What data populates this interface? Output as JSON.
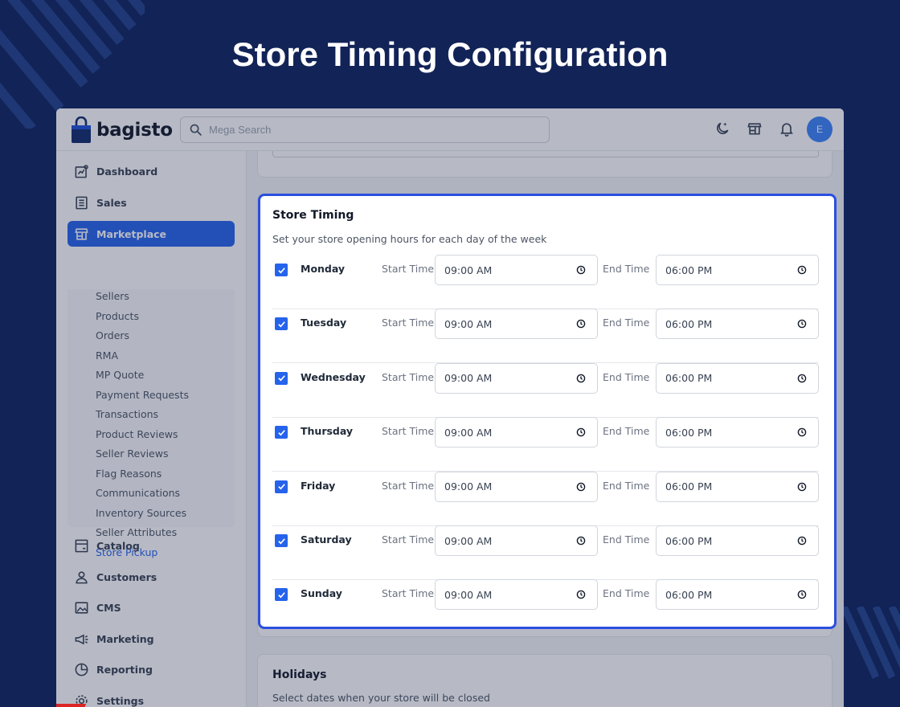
{
  "hero": {
    "title": "Store Timing Configuration"
  },
  "header": {
    "logo_text": "bagisto",
    "search_placeholder": "Mega Search",
    "avatar_initial": "E"
  },
  "sidebar": {
    "items": [
      {
        "label": "Dashboard",
        "icon": "dashboard-icon"
      },
      {
        "label": "Sales",
        "icon": "sales-icon"
      },
      {
        "label": "Marketplace",
        "icon": "store-icon",
        "active": true
      },
      {
        "label": "Catalog",
        "icon": "catalog-icon"
      },
      {
        "label": "Customers",
        "icon": "customers-icon"
      },
      {
        "label": "CMS",
        "icon": "cms-icon"
      },
      {
        "label": "Marketing",
        "icon": "megaphone-icon"
      },
      {
        "label": "Reporting",
        "icon": "pie-chart-icon"
      },
      {
        "label": "Settings",
        "icon": "gear-icon"
      }
    ],
    "marketplace_subitems": [
      "Sellers",
      "Products",
      "Orders",
      "RMA",
      "MP Quote",
      "Payment Requests",
      "Transactions",
      "Product Reviews",
      "Seller Reviews",
      "Flag Reasons",
      "Communications",
      "Inventory Sources",
      "Seller Attributes",
      "Store Pickup"
    ],
    "current_subitem": "Store Pickup"
  },
  "store_timing": {
    "title": "Store Timing",
    "subtitle": "Set your store opening hours for each day of the week",
    "start_label": "Start Time",
    "end_label": "End Time",
    "days": [
      {
        "day": "Monday",
        "checked": true,
        "start": "09:00 AM",
        "end": "06:00 PM"
      },
      {
        "day": "Tuesday",
        "checked": true,
        "start": "09:00 AM",
        "end": "06:00 PM"
      },
      {
        "day": "Wednesday",
        "checked": true,
        "start": "09:00 AM",
        "end": "06:00 PM"
      },
      {
        "day": "Thursday",
        "checked": true,
        "start": "09:00 AM",
        "end": "06:00 PM"
      },
      {
        "day": "Friday",
        "checked": true,
        "start": "09:00 AM",
        "end": "06:00 PM"
      },
      {
        "day": "Saturday",
        "checked": true,
        "start": "09:00 AM",
        "end": "06:00 PM"
      },
      {
        "day": "Sunday",
        "checked": true,
        "start": "09:00 AM",
        "end": "06:00 PM"
      }
    ]
  },
  "holidays": {
    "title": "Holidays",
    "subtitle": "Select dates when your store will be closed"
  },
  "colors": {
    "background": "#122357",
    "accent": "#2563eb",
    "highlight_border": "#2b4fe0"
  }
}
